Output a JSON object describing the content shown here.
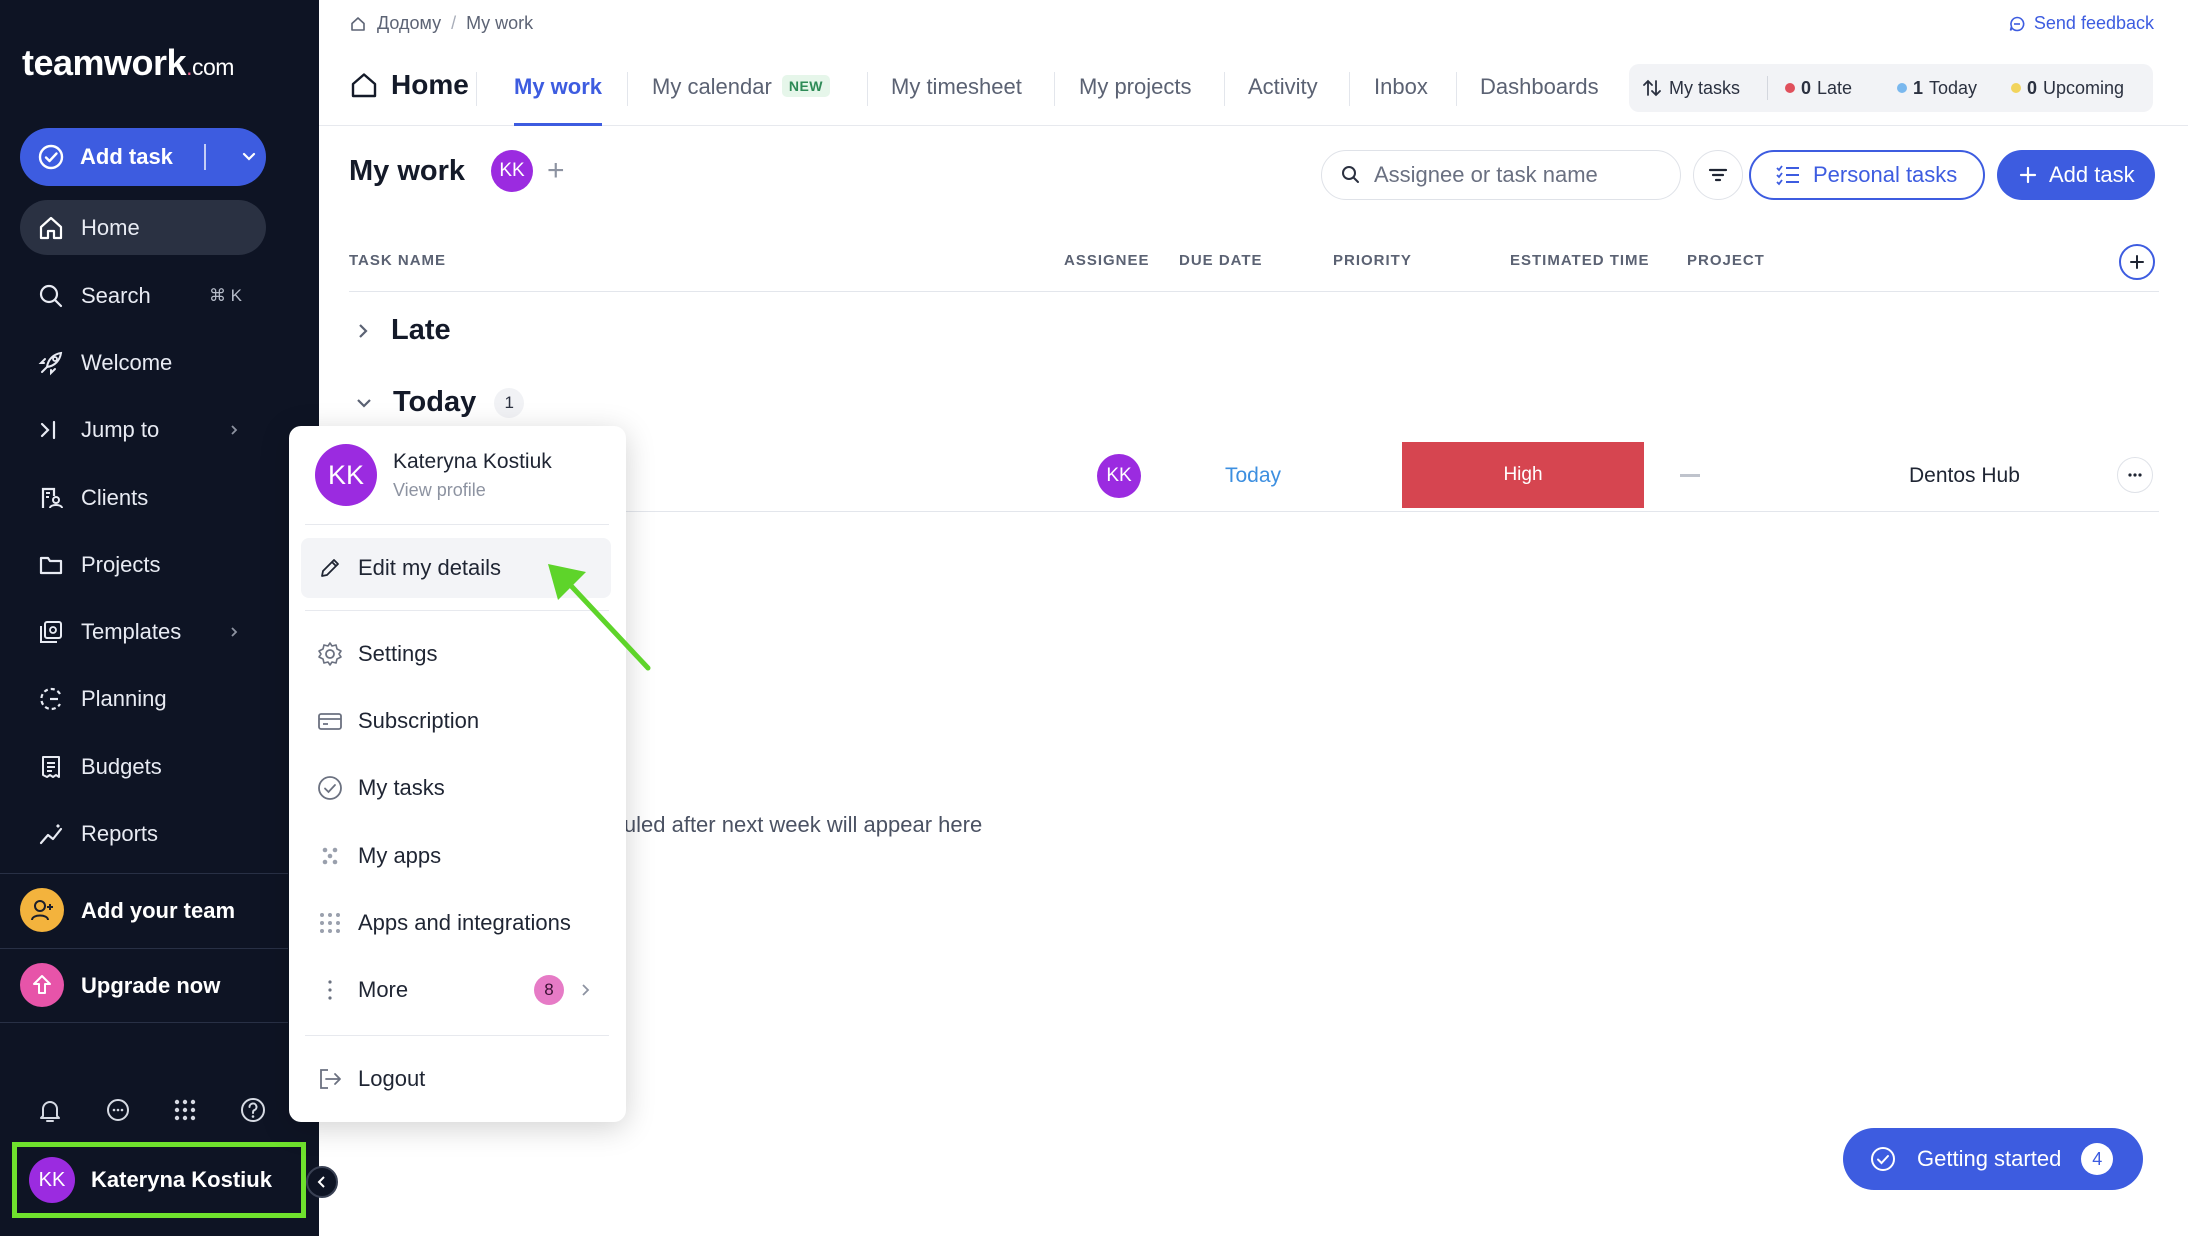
{
  "sidebar": {
    "logo_main": "teamwork",
    "logo_suffix": "com",
    "add_task_label": "Add task",
    "nav": [
      {
        "label": "Home",
        "icon": "home-icon"
      },
      {
        "label": "Search",
        "icon": "search-icon",
        "hint": "⌘ K"
      },
      {
        "label": "Welcome",
        "icon": "rocket-icon"
      },
      {
        "label": "Jump to",
        "icon": "jump-icon"
      },
      {
        "label": "Clients",
        "icon": "clients-icon"
      },
      {
        "label": "Projects",
        "icon": "folder-icon"
      },
      {
        "label": "Templates",
        "icon": "templates-icon"
      },
      {
        "label": "Planning",
        "icon": "planning-icon"
      },
      {
        "label": "Budgets",
        "icon": "budgets-icon"
      },
      {
        "label": "Reports",
        "icon": "reports-icon"
      }
    ],
    "add_team_label": "Add your team",
    "upgrade_label": "Upgrade now",
    "user": {
      "initials": "KK",
      "name": "Kateryna Kostiuk"
    }
  },
  "topbar": {
    "breadcrumb_home": "Додому",
    "breadcrumb_sep": "/",
    "breadcrumb_current": "My work",
    "feedback": "Send feedback"
  },
  "tabs": {
    "home": "Home",
    "items": [
      "My work",
      "My calendar",
      "My timesheet",
      "My projects",
      "Activity",
      "Inbox",
      "Dashboards"
    ],
    "new_badge": "NEW",
    "summary": {
      "my_tasks": "My tasks",
      "late_count": "0",
      "late_label": "Late",
      "today_count": "1",
      "today_label": "Today",
      "upcoming_count": "0",
      "upcoming_label": "Upcoming"
    }
  },
  "page": {
    "title": "My work",
    "owner_initials": "KK",
    "add": "+",
    "search_placeholder": "Assignee or task name",
    "personal_tasks": "Personal tasks",
    "add_task": "Add task"
  },
  "table": {
    "columns": [
      "TASK NAME",
      "ASSIGNEE",
      "DUE DATE",
      "PRIORITY",
      "ESTIMATED TIME",
      "PROJECT"
    ],
    "groups": {
      "late": "Late",
      "today": "Today",
      "today_count": "1"
    },
    "row": {
      "assignee": "KK",
      "due": "Today",
      "priority": "High",
      "project": "Dentos Hub"
    },
    "empty_hint": "luled after next week will appear here"
  },
  "user_menu": {
    "initials": "KK",
    "name": "Kateryna Kostiuk",
    "view_profile": "View profile",
    "items": [
      "Edit my details",
      "Settings",
      "Subscription",
      "My tasks",
      "My apps",
      "Apps and integrations",
      "More",
      "Logout"
    ],
    "more_count": "8"
  },
  "getting_started": {
    "label": "Getting started",
    "count": "4"
  },
  "colors": {
    "sidebar_bg": "#0e1424",
    "accent": "#3d5ce0",
    "priority_high": "#d64550",
    "annotation": "#6fe22d",
    "avatar": "#9b2be0"
  }
}
